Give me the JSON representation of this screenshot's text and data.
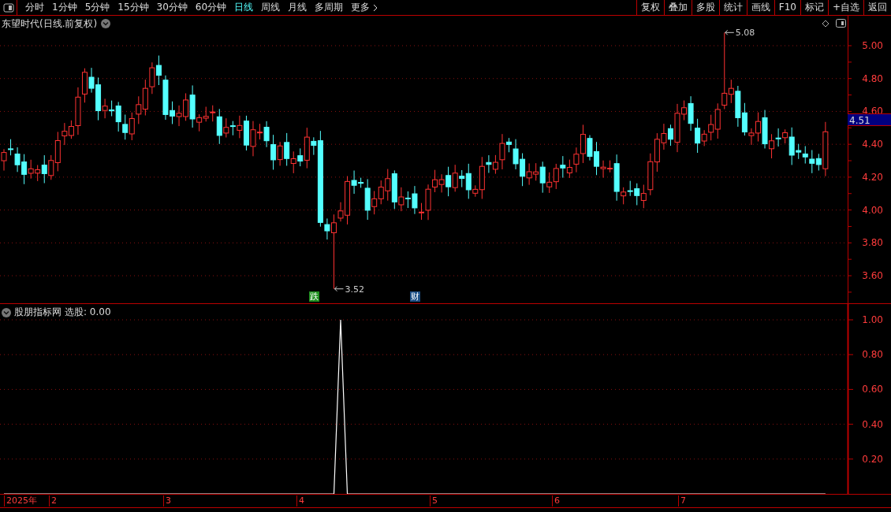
{
  "toolbar": {
    "tabs": [
      {
        "label": "分时",
        "selected": false
      },
      {
        "label": "1分钟",
        "selected": false
      },
      {
        "label": "5分钟",
        "selected": false
      },
      {
        "label": "15分钟",
        "selected": false
      },
      {
        "label": "30分钟",
        "selected": false
      },
      {
        "label": "60分钟",
        "selected": false
      },
      {
        "label": "日线",
        "selected": true
      },
      {
        "label": "周线",
        "selected": false
      },
      {
        "label": "月线",
        "selected": false
      },
      {
        "label": "多周期",
        "selected": false
      }
    ],
    "more": "更多",
    "buttons": [
      "复权",
      "叠加",
      "多股",
      "统计",
      "画线",
      "F10",
      "标记",
      "+自选",
      "返回"
    ]
  },
  "price_panel": {
    "title": "东望时代(日线.前复权)",
    "y_axis_labels": [
      "5.00",
      "4.80",
      "4.60",
      "4.40",
      "4.20",
      "4.00",
      "3.80",
      "3.60"
    ],
    "current_price": "4.51",
    "high_label": "5.08",
    "low_label": "3.52",
    "event_markers": [
      {
        "label": "跌",
        "color": "#1f8f1f"
      },
      {
        "label": "财",
        "color": "#1c4f86"
      }
    ]
  },
  "indicator_panel": {
    "title": "股朋指标网",
    "reading": "选股: 0.00",
    "chart_data": {
      "type": "line",
      "ylim": [
        0,
        1
      ],
      "grid": true,
      "yticks": [
        {
          "value": 1,
          "label": "1.00"
        },
        {
          "value": 0.8,
          "label": "0.80"
        },
        {
          "value": 0.6,
          "label": "0.60"
        },
        {
          "value": 0.4,
          "label": "0.40"
        },
        {
          "value": 0.2,
          "label": "0.20"
        }
      ],
      "series": [
        {
          "color": "#ffffff",
          "values": [
            0,
            0,
            0,
            0,
            0,
            0,
            0,
            0,
            0,
            0,
            0,
            0,
            0,
            0,
            0,
            0,
            0,
            0,
            0,
            0,
            0,
            0,
            0,
            0,
            0,
            0,
            0,
            0,
            0,
            0,
            0,
            0,
            0,
            0,
            0,
            0,
            0,
            0,
            0,
            0,
            0,
            0,
            0,
            0,
            0,
            0,
            0,
            0,
            0,
            0,
            1,
            0,
            0,
            0,
            0,
            0,
            0,
            0,
            0,
            0,
            0,
            0,
            0,
            0,
            0,
            0,
            0,
            0,
            0,
            0,
            0,
            0,
            0,
            0,
            0,
            0,
            0,
            0,
            0,
            0,
            0,
            0,
            0,
            0,
            0,
            0,
            0,
            0,
            0,
            0,
            0,
            0,
            0,
            0,
            0,
            0,
            0,
            0,
            0,
            0,
            0,
            0,
            0,
            0,
            0,
            0,
            0,
            0,
            0,
            0,
            0,
            0,
            0,
            0,
            0,
            0,
            0,
            0,
            0,
            0,
            0,
            0,
            0
          ]
        }
      ]
    }
  },
  "date_axis": [
    "2025年",
    "2",
    "3",
    "4",
    "5",
    "6",
    "7"
  ]
}
